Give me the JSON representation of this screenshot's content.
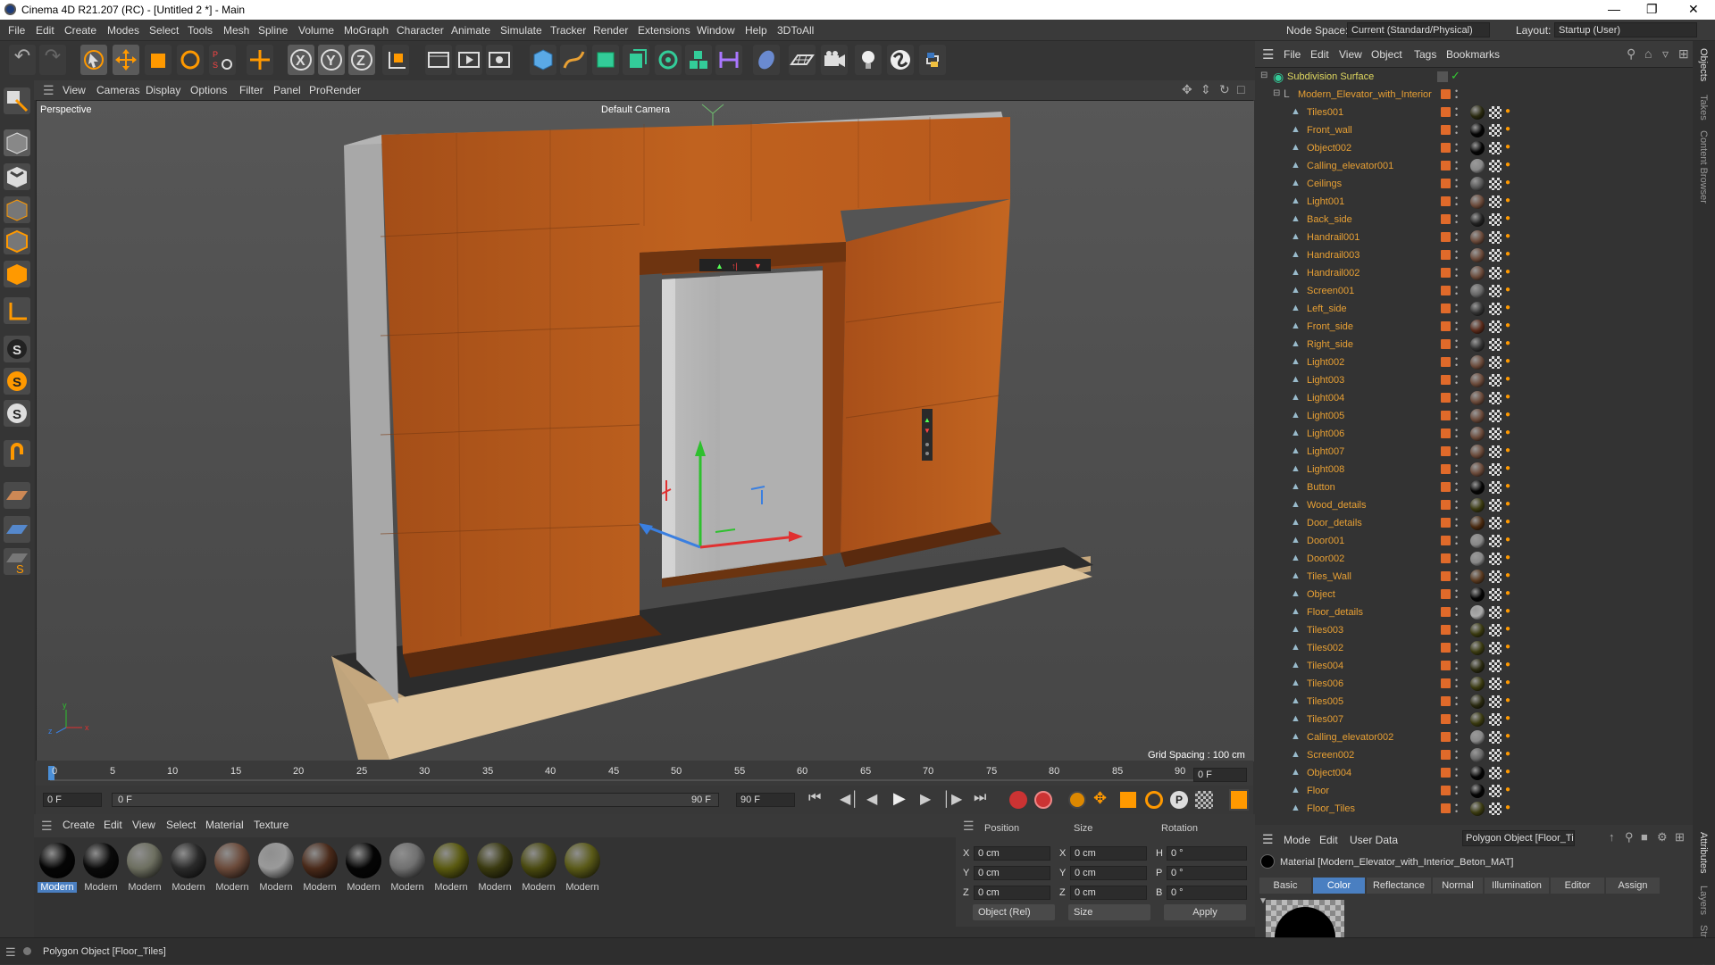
{
  "app": {
    "title": "Cinema 4D R21.207 (RC) - [Untitled 2 *] - Main"
  },
  "menu": [
    "File",
    "Edit",
    "Create",
    "Modes",
    "Select",
    "Tools",
    "Mesh",
    "Spline",
    "Volume",
    "MoGraph",
    "Character",
    "Animate",
    "Simulate",
    "Tracker",
    "Render",
    "Extensions",
    "Window",
    "Help",
    "3DToAll"
  ],
  "node_space": {
    "label": "Node Space:",
    "value": "Current (Standard/Physical)"
  },
  "layout": {
    "label": "Layout:",
    "value": "Startup (User)"
  },
  "viewport": {
    "menu": [
      "View",
      "Cameras",
      "Display",
      "Options",
      "Filter",
      "Panel",
      "ProRender"
    ],
    "label": "Perspective",
    "camera": "Default Camera",
    "grid_spacing": "Grid Spacing : 100 cm"
  },
  "timeline": {
    "ticks": [
      "0",
      "5",
      "10",
      "15",
      "20",
      "25",
      "30",
      "35",
      "40",
      "45",
      "50",
      "55",
      "60",
      "65",
      "70",
      "75",
      "80",
      "85",
      "90"
    ],
    "end_field": "0 F",
    "current": "0 F",
    "slider_start": "0 F",
    "slider_end": "90 F",
    "max": "90 F"
  },
  "materials": {
    "menu": [
      "Create",
      "Edit",
      "View",
      "Select",
      "Material",
      "Texture"
    ],
    "items": [
      {
        "label": "Modern",
        "color": "#050505"
      },
      {
        "label": "Modern",
        "color": "#0a0a0a"
      },
      {
        "label": "Modern",
        "color": "#6d6f60"
      },
      {
        "label": "Modern",
        "color": "#2a2a2a"
      },
      {
        "label": "Modern",
        "color": "#6b4a3a"
      },
      {
        "label": "Modern",
        "color": "#9a9a9a"
      },
      {
        "label": "Modern",
        "color": "#4a2a1a"
      },
      {
        "label": "Modern",
        "color": "#050505"
      },
      {
        "label": "Modern",
        "color": "#707070"
      },
      {
        "label": "Modern",
        "color": "#5a5a10"
      },
      {
        "label": "Modern",
        "color": "#3a3a10"
      },
      {
        "label": "Modern",
        "color": "#4a4a10"
      },
      {
        "label": "Modern",
        "color": "#5a5a18"
      }
    ]
  },
  "coords": {
    "headers": [
      "Position",
      "Size",
      "Rotation"
    ],
    "rows": [
      {
        "a": "X",
        "pos": "0 cm",
        "b": "X",
        "size": "0 cm",
        "c": "H",
        "rot": "0 °"
      },
      {
        "a": "Y",
        "pos": "0 cm",
        "b": "Y",
        "size": "0 cm",
        "c": "P",
        "rot": "0 °"
      },
      {
        "a": "Z",
        "pos": "0 cm",
        "b": "Z",
        "size": "0 cm",
        "c": "B",
        "rot": "0 °"
      }
    ],
    "mode": "Object (Rel)",
    "size_mode": "Size",
    "apply": "Apply"
  },
  "objects": {
    "menu": [
      "File",
      "Edit",
      "View",
      "Object",
      "Tags",
      "Bookmarks"
    ],
    "root": "Subdivision Surface",
    "group": "Modern_Elevator_with_Interior",
    "items": [
      {
        "name": "Tiles001",
        "ball": "#2a2a10"
      },
      {
        "name": "Front_wall",
        "ball": "#050505"
      },
      {
        "name": "Object002",
        "ball": "#050505"
      },
      {
        "name": "Calling_elevator001",
        "ball": "#888"
      },
      {
        "name": "Ceilings",
        "ball": "#555"
      },
      {
        "name": "Light001",
        "ball": "#6b4a3a"
      },
      {
        "name": "Back_side",
        "ball": "#222"
      },
      {
        "name": "Handrail001",
        "ball": "#6b4a3a"
      },
      {
        "name": "Handrail003",
        "ball": "#6b4a3a"
      },
      {
        "name": "Handrail002",
        "ball": "#6b4a3a"
      },
      {
        "name": "Screen001",
        "ball": "#666"
      },
      {
        "name": "Left_side",
        "ball": "#333"
      },
      {
        "name": "Front_side",
        "ball": "#5a2a1a"
      },
      {
        "name": "Right_side",
        "ball": "#333"
      },
      {
        "name": "Light002",
        "ball": "#6b4a3a"
      },
      {
        "name": "Light003",
        "ball": "#6b4a3a"
      },
      {
        "name": "Light004",
        "ball": "#6b4a3a"
      },
      {
        "name": "Light005",
        "ball": "#6b4a3a"
      },
      {
        "name": "Light006",
        "ball": "#6b4a3a"
      },
      {
        "name": "Light007",
        "ball": "#6b4a3a"
      },
      {
        "name": "Light008",
        "ball": "#6b4a3a"
      },
      {
        "name": "Button",
        "ball": "#050505"
      },
      {
        "name": "Wood_details",
        "ball": "#3a3a10"
      },
      {
        "name": "Door_details",
        "ball": "#4a2a10"
      },
      {
        "name": "Door001",
        "ball": "#888"
      },
      {
        "name": "Door002",
        "ball": "#888"
      },
      {
        "name": "Tiles_Wall",
        "ball": "#5a3a20"
      },
      {
        "name": "Object",
        "ball": "#050505"
      },
      {
        "name": "Floor_details",
        "ball": "#aaa"
      },
      {
        "name": "Tiles003",
        "ball": "#3a3a10"
      },
      {
        "name": "Tiles002",
        "ball": "#3a3a10"
      },
      {
        "name": "Tiles004",
        "ball": "#2a2a10"
      },
      {
        "name": "Tiles006",
        "ball": "#3a3a10"
      },
      {
        "name": "Tiles005",
        "ball": "#2a2a10"
      },
      {
        "name": "Tiles007",
        "ball": "#3a3a10"
      },
      {
        "name": "Calling_elevator002",
        "ball": "#888"
      },
      {
        "name": "Screen002",
        "ball": "#666"
      },
      {
        "name": "Object004",
        "ball": "#050505"
      },
      {
        "name": "Floor",
        "ball": "#050505"
      },
      {
        "name": "Floor_Tiles",
        "ball": "#3a3a10"
      }
    ]
  },
  "attributes": {
    "menu": [
      "Mode",
      "Edit",
      "User Data"
    ],
    "selection": "Polygon Object [Floor_Tiles]",
    "material": "Material [Modern_Elevator_with_Interior_Beton_MAT]",
    "tabs": [
      "Basic",
      "Color",
      "Reflectance",
      "Normal",
      "Illumination",
      "Editor",
      "Assign"
    ],
    "active_tab": "Color"
  },
  "right_strip": [
    "Objects",
    "Takes",
    "Content Browser",
    "Attributes",
    "Layers",
    "Structure"
  ],
  "status": "Polygon Object [Floor_Tiles]",
  "colors": {
    "accent": "#e8a034",
    "active_tab": "#4a7fc1",
    "wood": "#b45a1e"
  }
}
